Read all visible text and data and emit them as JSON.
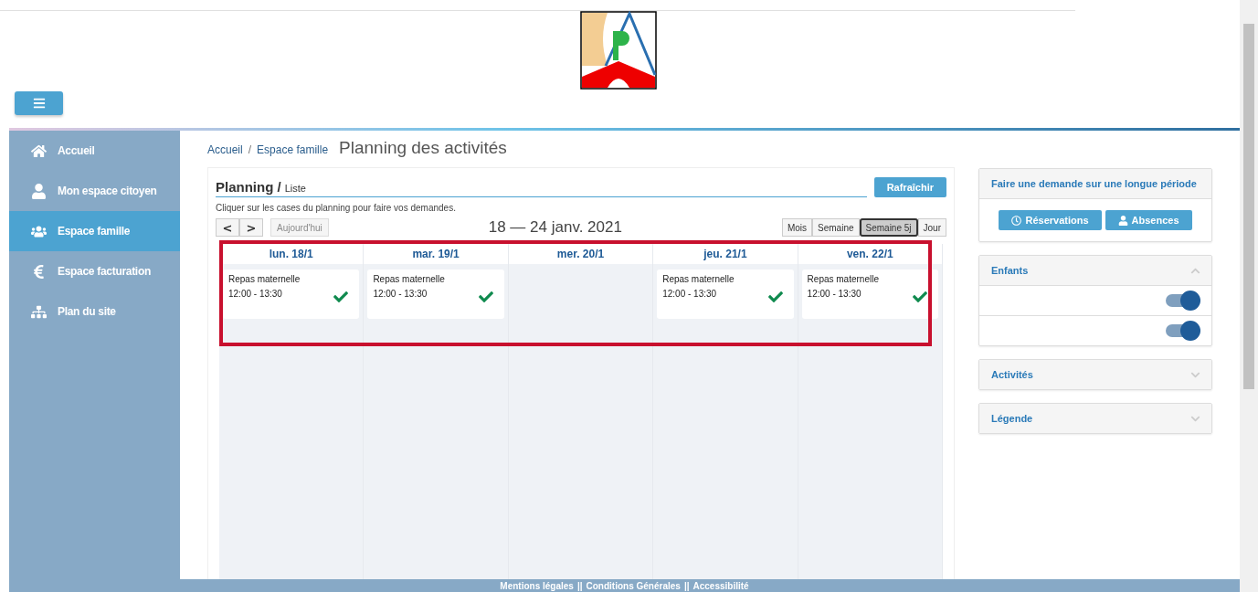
{
  "sidebar": {
    "items": [
      {
        "label": "Accueil",
        "selected": false
      },
      {
        "label": "Mon espace citoyen",
        "selected": false
      },
      {
        "label": "Espace famille",
        "selected": true
      },
      {
        "label": "Espace facturation",
        "selected": false
      },
      {
        "label": "Plan du site",
        "selected": false
      }
    ]
  },
  "breadcrumb": [
    "Accueil",
    "/",
    "Espace famille"
  ],
  "page_title": "Planning des activités",
  "planning": {
    "title": "Planning",
    "separator": "/",
    "subtitle": "Liste",
    "refresh_button": "Rafraîchir",
    "hint": "Cliquer sur les cases du planning pour faire vos demandes.",
    "prev": "<",
    "next": ">",
    "today_button": "Aujourd'hui",
    "today_disabled": true,
    "range": "18 — 24 janv. 2021",
    "views": [
      {
        "label": "Mois",
        "selected": false
      },
      {
        "label": "Semaine",
        "selected": false
      },
      {
        "label": "Semaine 5j",
        "selected": true
      },
      {
        "label": "Jour",
        "selected": false
      }
    ],
    "days": [
      {
        "label": "lun. 18/1",
        "events": [
          {
            "title": "Repas maternelle",
            "time": "12:00 - 13:30",
            "confirmed": true
          }
        ]
      },
      {
        "label": "mar. 19/1",
        "events": [
          {
            "title": "Repas maternelle",
            "time": "12:00 - 13:30",
            "confirmed": true
          }
        ]
      },
      {
        "label": "mer. 20/1"
      },
      {
        "label": "jeu. 21/1",
        "events": [
          {
            "title": "Repas maternelle",
            "time": "12:00 - 13:30",
            "confirmed": true
          }
        ]
      },
      {
        "label": "ven. 22/1",
        "events": [
          {
            "title": "Repas maternelle",
            "time": "12:00 - 13:30",
            "confirmed": true
          }
        ]
      }
    ]
  },
  "long_request": {
    "title": "Faire une demande sur une longue période",
    "buttons": [
      {
        "label": "Réservations"
      },
      {
        "label": "Absences"
      }
    ]
  },
  "panels": [
    {
      "title": "Enfants",
      "expanded": true,
      "children": [
        {
          "on": true
        },
        {
          "on": true
        }
      ]
    },
    {
      "title": "Activités",
      "expanded": false
    },
    {
      "title": "Légende",
      "expanded": false
    }
  ],
  "footer": [
    "Mentions légales",
    "||",
    "Conditions Générales",
    "||",
    "Accessibilité"
  ]
}
